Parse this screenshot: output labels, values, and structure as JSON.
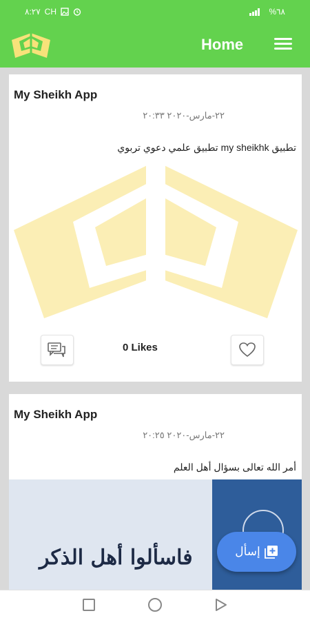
{
  "status_bar": {
    "time": "٨:٢٧",
    "left_text": "CH",
    "right_text": "%٦٨"
  },
  "appbar": {
    "title": "Home",
    "logo_icon": "book-logo-icon",
    "menu_icon": "hamburger-menu-icon"
  },
  "posts": [
    {
      "author": "My Sheikh App",
      "date": "٢٢-مارس-٢٠٢٠ ٢٠:٣٣",
      "text": "تطبيق my sheikhk تطبيق علمي دعوي تربوي",
      "likes_label": "0 Likes",
      "comment_icon": "comment-icon",
      "like_icon": "heart-icon"
    },
    {
      "author": "My Sheikh App",
      "date": "٢٢-مارس-٢٠٢٠ ٢٠:٢٥",
      "text": "أمر الله تعالى بسؤال أهل العلم",
      "banner_text": "فاسألوا أهل الذكر"
    }
  ],
  "fab": {
    "label": "إسأل",
    "icon": "add-box-icon"
  },
  "colors": {
    "header": "#63d24e",
    "fab": "#4a86e8",
    "logo": "#f7e27a",
    "watermark": "#fbeeb5"
  }
}
